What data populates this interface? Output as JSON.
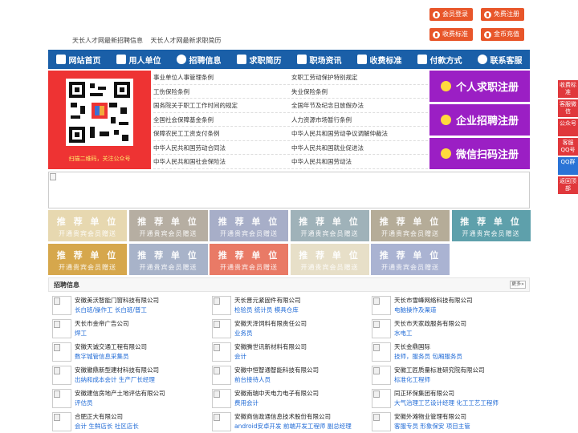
{
  "top_buttons": [
    {
      "label": "会员登录",
      "icon": "user-icon"
    },
    {
      "label": "免费注册",
      "icon": "register-icon"
    },
    {
      "label": "收费标准",
      "icon": "fee-icon"
    },
    {
      "label": "金币充值",
      "icon": "coin-icon"
    }
  ],
  "site_links": [
    "天长人才网最新招聘信息",
    "天长人才网最新求职简历"
  ],
  "nav": [
    {
      "label": "网站首页",
      "icon": "home-icon"
    },
    {
      "label": "用人单位",
      "icon": "building-icon"
    },
    {
      "label": "招聘信息",
      "icon": "recruit-icon"
    },
    {
      "label": "求职简历",
      "icon": "resume-icon"
    },
    {
      "label": "职场资讯",
      "icon": "news-icon"
    },
    {
      "label": "收费标准",
      "icon": "fee-icon"
    },
    {
      "label": "付款方式",
      "icon": "payment-icon"
    },
    {
      "label": "联系客服",
      "icon": "phone-icon"
    }
  ],
  "qr_caption": "扫描二维码，关注公众号",
  "policy_left": [
    "事业单位人事管理条例",
    "工伤保险条例",
    "国务院关于职工工作时间的规定",
    "全国社会保障基金条例",
    "保障农民工工资支付条例",
    "中华人民共和国劳动合同法",
    "中华人民共和国社会保险法"
  ],
  "policy_right": [
    "女职工劳动保护特别规定",
    "失业保险条例",
    "全国年节及纪念日放假办法",
    "人力资源市场暂行条例",
    "中华人民共和国劳动争议调解仲裁法",
    "中华人民共和国就业促进法",
    "中华人民共和国劳动法"
  ],
  "register_buttons": [
    {
      "label": "个人求职注册",
      "icon": "person-icon"
    },
    {
      "label": "企业招聘注册",
      "icon": "company-icon"
    },
    {
      "label": "微信扫码注册",
      "icon": "wechat-icon"
    }
  ],
  "tiles": [
    {
      "title": "推 荐 单 位",
      "sub": "开通贵宾会员赠送",
      "color": "#e7d8b0"
    },
    {
      "title": "推 荐 单 位",
      "sub": "开通贵宾会员赠送",
      "color": "#b6aea2"
    },
    {
      "title": "推 荐 单 位",
      "sub": "开通贵宾会员赠送",
      "color": "#a7aec8"
    },
    {
      "title": "推 荐 单 位",
      "sub": "开通贵宾会员赠送",
      "color": "#9fb2b9"
    },
    {
      "title": "推 荐 单 位",
      "sub": "开通贵宾会员赠送",
      "color": "#b5ac98"
    },
    {
      "title": "推 荐 单 位",
      "sub": "开通贵宾会员赠送",
      "color": "#5ea0ab"
    },
    {
      "title": "推 荐 单 位",
      "sub": "开通贵宾会员赠送",
      "color": "#d6a74c"
    },
    {
      "title": "推 荐 单 位",
      "sub": "开通贵宾会员赠送",
      "color": "#a8b3c9"
    },
    {
      "title": "推 荐 单 位",
      "sub": "开通贵宾会员赠送",
      "color": "#e97a66"
    },
    {
      "title": "推 荐 单 位",
      "sub": "开通贵宾会员赠送",
      "color": "#e7dfc8"
    },
    {
      "title": "推 荐 单 位",
      "sub": "开通贵宾会员赠送",
      "color": "#aab3d2"
    }
  ],
  "jobs_title": "招聘信息",
  "more_label": "更多»",
  "jobs": [
    {
      "company": "安徽美沃智能门窗科技有限公司",
      "positions": "长白班/操作工 长白班/普工"
    },
    {
      "company": "天长晋元紧固件有限公司",
      "positions": "检验员 统计员 模具仓库"
    },
    {
      "company": "天长市雪峰网络科技有限公司",
      "positions": "电脑操作及渠道"
    },
    {
      "company": "天长市金帝广告公司",
      "positions": "焊工"
    },
    {
      "company": "安徽天泽饲料有限责任公司",
      "positions": "业务员"
    },
    {
      "company": "天长市天家政服务有限公司",
      "positions": "水电工"
    },
    {
      "company": "安徽天诚交通工程有限公司",
      "positions": "数字城管信息采集员"
    },
    {
      "company": "安徽腾世讯新材料有限公司",
      "positions": "会计"
    },
    {
      "company": "天长金鼎国际",
      "positions": "技师，服务员 包厢服务员"
    },
    {
      "company": "安徽徽鼎新型建材科技有限公司",
      "positions": "出纳和成本会计 生产厂长经理"
    },
    {
      "company": "安徽中恒智通智能科技有限公司",
      "positions": "前台接待人员"
    },
    {
      "company": "安徽工匠质量标准研究院有限公司",
      "positions": "标准化工程师"
    },
    {
      "company": "安徽建信房地产土地评估有限公司",
      "positions": "评估员"
    },
    {
      "company": "安徽南瑞中天电力电子有限公司",
      "positions": "费用会计"
    },
    {
      "company": "同正环保集团有限公司",
      "positions": "大气治理工艺设计经理 化工工艺工程师"
    },
    {
      "company": "合肥正大有限公司",
      "positions": "会计 生鲜店长 社区店长"
    },
    {
      "company": "安徽商信政通信息技术股份有限公司",
      "positions": "android安卓开发 前端开发工程师 副总经理"
    },
    {
      "company": "安徽外滩物业管理有限公司",
      "positions": "客服专员 形象保安 项目主管"
    }
  ],
  "side_buttons": [
    {
      "label": "收费标准",
      "color": "#e0383c"
    },
    {
      "label": "客服微信",
      "color": "#e0383c"
    },
    {
      "label": "公众号",
      "color": "#e0383c"
    },
    {
      "label": "客服QQ号",
      "color": "#e0383c"
    },
    {
      "label": "QQ群",
      "color": "#2a73d6"
    },
    {
      "label": "返回顶部",
      "color": "#e0383c"
    }
  ]
}
